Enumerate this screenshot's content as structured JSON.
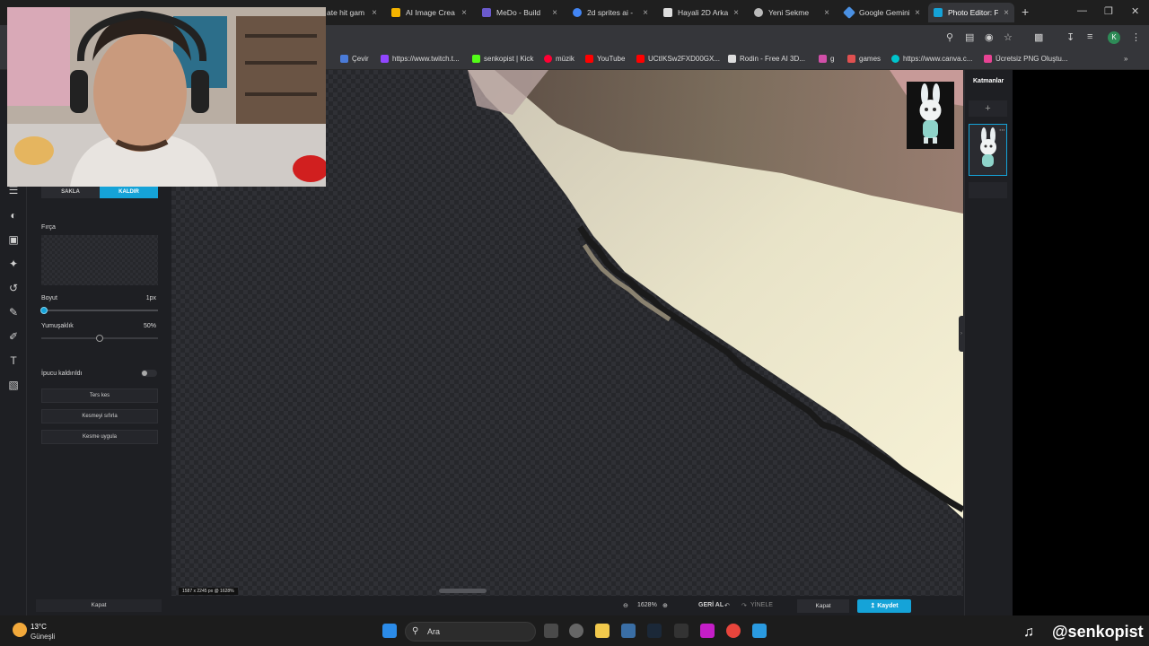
{
  "browser": {
    "tabs": [
      {
        "title": "ate hit gam",
        "color": "#888888"
      },
      {
        "title": "AI Image Crea",
        "color": "#f4b400"
      },
      {
        "title": "MeDo - Build",
        "color": "#6a5acd"
      },
      {
        "title": "2d sprites ai -",
        "color": "#4285f4"
      },
      {
        "title": "Hayali 2D Arka",
        "color": "#dddddd"
      },
      {
        "title": "Yeni Sekme",
        "color": "#bbbbbb"
      },
      {
        "title": "Google Gemini",
        "color": "#4a90e2"
      },
      {
        "title": "Photo Editor: F",
        "color": "#15a3d8",
        "active": true
      }
    ],
    "close_glyph": "×",
    "newtab_glyph": "+",
    "profile_initial": "K",
    "bookmarks": [
      {
        "label": "Çevir",
        "color": "#4a7bd8"
      },
      {
        "label": "https://www.twitch.t...",
        "color": "#9146ff"
      },
      {
        "label": "senkopist | Kick",
        "color": "#53fc18"
      },
      {
        "label": "müzik",
        "color": "#ff0033"
      },
      {
        "label": "YouTube",
        "color": "#ff0000"
      },
      {
        "label": "UCtIKSw2FXD00GX...",
        "color": "#ff0000"
      },
      {
        "label": "Rodin - Free AI 3D...",
        "color": "#dddddd"
      },
      {
        "label": "g",
        "color": "#d14fa8"
      },
      {
        "label": "games",
        "color": "#e05050"
      },
      {
        "label": "https://www.canva.c...",
        "color": "#00c4cc"
      },
      {
        "label": "Ücretsiz PNG Oluştu...",
        "color": "#e84393"
      }
    ]
  },
  "editor": {
    "panel": {
      "seg_left": "SAKLA",
      "seg_right": "KALDIR",
      "brush_label": "Fırça",
      "size_label": "Boyut",
      "size_value": "1px",
      "size_fraction": 0.02,
      "softness_label": "Yumuşaklık",
      "softness_value": "50%",
      "softness_fraction": 0.5,
      "hint_label": "İpucu kaldırıldı",
      "invert_button": "Ters kes",
      "reset_button": "Kesmeyi sıfırla",
      "apply_button": "Kesme uygula",
      "close_button": "Kapat"
    },
    "canvas_readout": "1587 x 2245 px @ 1628%",
    "zoom": "1628%",
    "undo_label": "GERİ AL",
    "redo_label": "YİNELE",
    "close_button": "Kapat",
    "save_button": "Kaydet",
    "layers_title": "Katmanlar",
    "layers_add": "+"
  },
  "taskbar": {
    "temperature": "13°C",
    "condition": "Güneşli",
    "search_placeholder": "Ara",
    "watermark": "@senkopist"
  }
}
